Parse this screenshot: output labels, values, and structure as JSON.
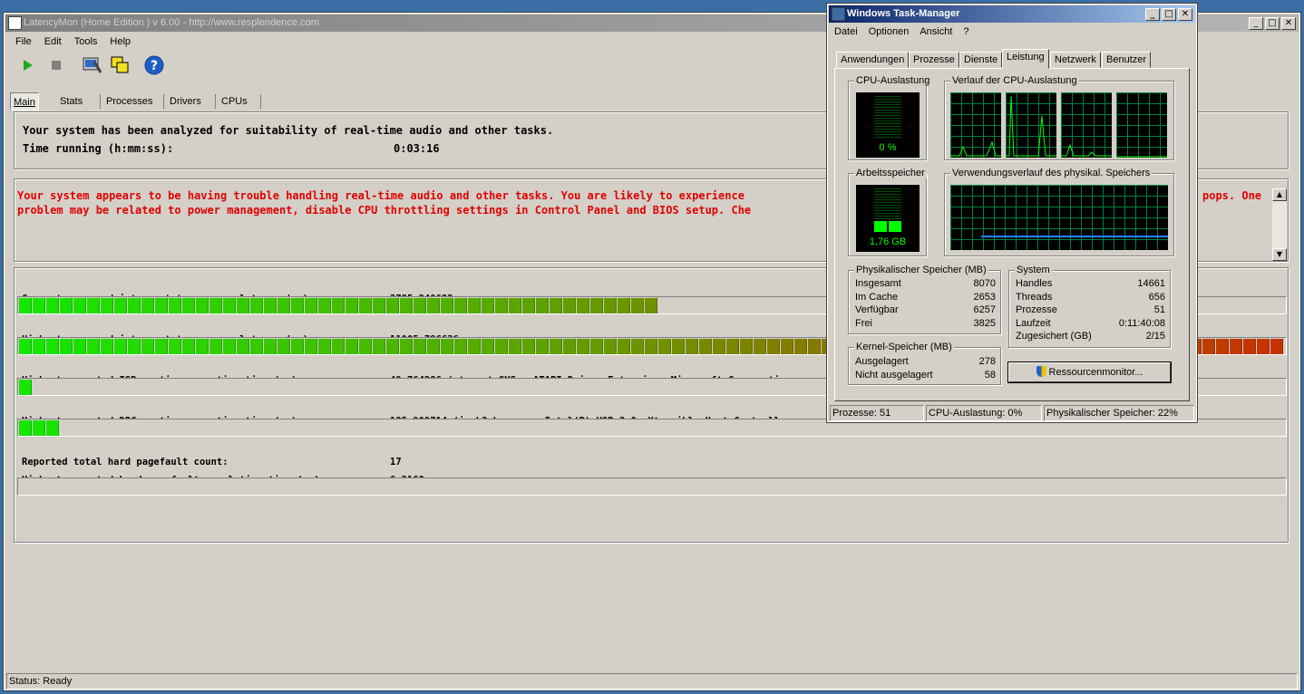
{
  "latencymon": {
    "title": "LatencyMon  (Home Edition )  v 6.00 - http://www.resplendence.com",
    "menu": [
      "File",
      "Edit",
      "Tools",
      "Help"
    ],
    "tabs": [
      "Main",
      "Stats",
      "Processes",
      "Drivers",
      "CPUs"
    ],
    "summary": {
      "line1": "Your system has been analyzed for suitability of real-time audio and other tasks.",
      "time_label": "Time running (h:mm:ss):",
      "time_value": "0:03:16"
    },
    "warning": {
      "line1_left": "Your system appears to be having trouble handling real-time audio and other tasks. You are likely to experience",
      "line1_right": "pops. One",
      "line2_left": "problem may be related to power management, disable CPU throttling settings in Control Panel and BIOS setup. Che"
    },
    "metrics": [
      {
        "label": "Current measured interrupt to process latency (µs):",
        "value": "2785,240682",
        "fill": 0.5
      },
      {
        "label": "Highest measured interrupt to process latency (µs):",
        "value": "11005,796636",
        "fill": 1.0
      },
      {
        "label": "Highest reported ISR routine execution time (µs):",
        "value": "49,764286  (ataport.SYS - ATAPI Driver Extension, Microsoft Corporatio",
        "fill": 0.01
      },
      {
        "label": "Highest reported DPC routine execution time (µs):",
        "value": "125,909714  (iusb3xhc.sys - Intel(R) USB 3.0 eXtensible Host Controll",
        "fill": 0.03
      },
      {
        "label": "Reported total hard pagefault count:",
        "value": "17"
      },
      {
        "label": "Highest reported hard pagefault resolution time (µs):",
        "value": "6,2160",
        "fill": 0.0
      }
    ],
    "status": "Status: Ready"
  },
  "taskmgr": {
    "title": "Windows Task-Manager",
    "menu": [
      "Datei",
      "Optionen",
      "Ansicht",
      "?"
    ],
    "tabs": [
      "Anwendungen",
      "Prozesse",
      "Dienste",
      "Leistung",
      "Netzwerk",
      "Benutzer"
    ],
    "active_tab": "Leistung",
    "cpu_usage": {
      "label": "CPU-Auslastung",
      "value": "0 %",
      "percent": 0
    },
    "cpu_history": {
      "label": "Verlauf der CPU-Auslastung"
    },
    "memory": {
      "label": "Arbeitsspeicher",
      "value": "1,76 GB"
    },
    "memory_history": {
      "label": "Verwendungsverlauf des physikal. Speichers"
    },
    "physical": {
      "label": "Physikalischer Speicher (MB)",
      "rows": [
        {
          "k": "Insgesamt",
          "v": "8070"
        },
        {
          "k": "Im Cache",
          "v": "2653"
        },
        {
          "k": "Verfügbar",
          "v": "6257"
        },
        {
          "k": "Frei",
          "v": "3825"
        }
      ]
    },
    "system": {
      "label": "System",
      "rows": [
        {
          "k": "Handles",
          "v": "14661"
        },
        {
          "k": "Threads",
          "v": "656"
        },
        {
          "k": "Prozesse",
          "v": "51"
        },
        {
          "k": "Laufzeit",
          "v": "0:11:40:08"
        },
        {
          "k": "Zugesichert (GB)",
          "v": "2/15"
        }
      ]
    },
    "kernel": {
      "label": "Kernel-Speicher (MB)",
      "rows": [
        {
          "k": "Ausgelagert",
          "v": "278"
        },
        {
          "k": "Nicht ausgelagert",
          "v": "58"
        }
      ]
    },
    "resource_button": "Ressourcenmonitor...",
    "status": {
      "processes": "Prozesse: 51",
      "cpu": "CPU-Auslastung: 0%",
      "memory": "Physikalischer Speicher: 22%"
    }
  }
}
